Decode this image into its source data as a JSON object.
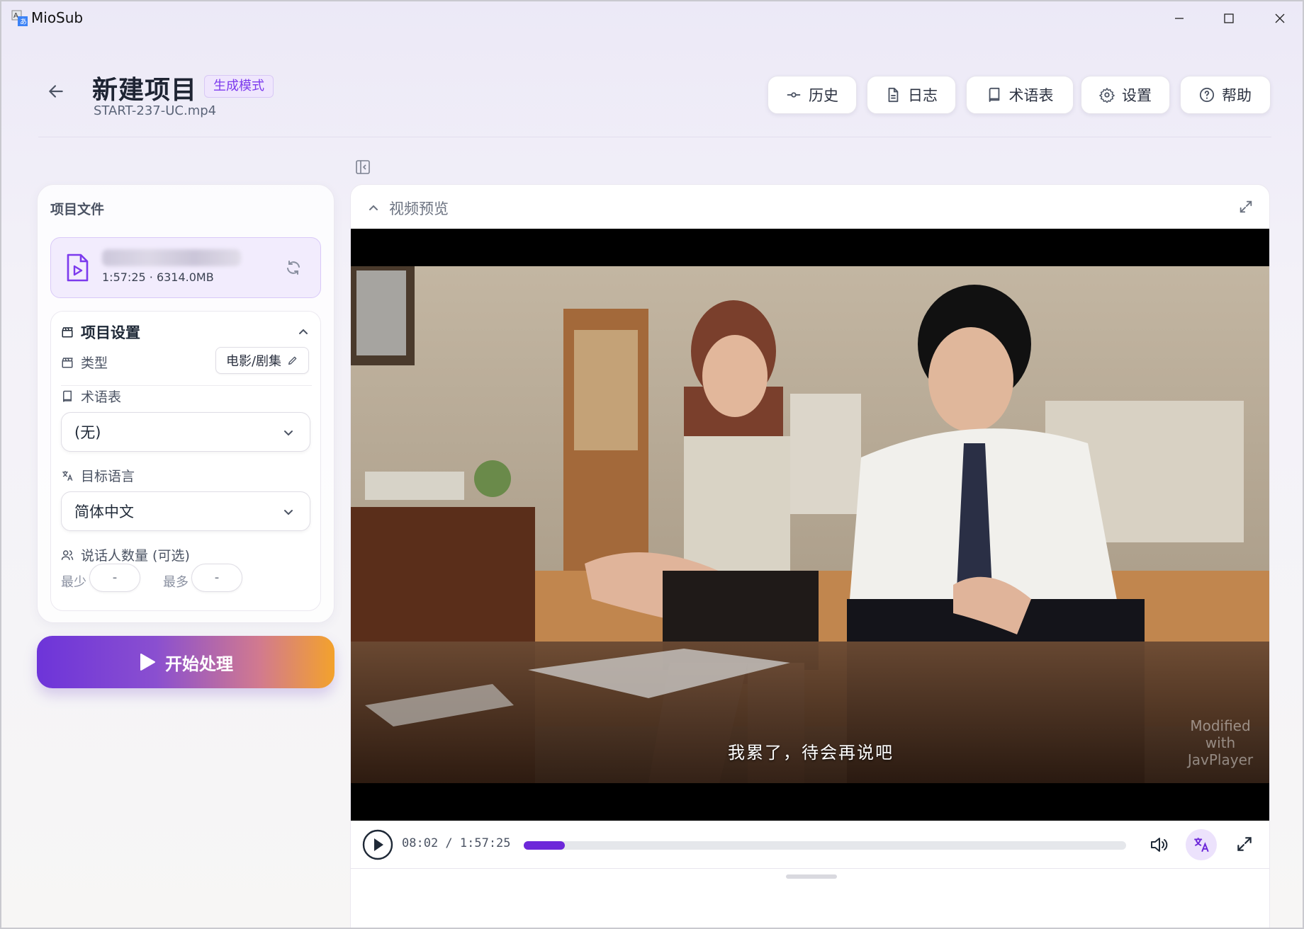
{
  "window": {
    "title": "MioSub"
  },
  "header": {
    "title": "新建项目",
    "mode_badge": "生成模式",
    "filename": "START-237-UC.mp4",
    "buttons": [
      {
        "label": "历史",
        "icon": "history-icon"
      },
      {
        "label": "日志",
        "icon": "document-icon"
      },
      {
        "label": "术语表",
        "icon": "book-icon"
      },
      {
        "label": "设置",
        "icon": "gear-icon"
      },
      {
        "label": "帮助",
        "icon": "help-icon"
      }
    ]
  },
  "sidebar": {
    "section_title": "项目文件",
    "file": {
      "meta": "1:57:25 · 6314.0MB"
    },
    "settings": {
      "title": "项目设置",
      "type_label": "类型",
      "type_value": "电影/剧集",
      "glossary_label": "术语表",
      "glossary_value": "(无)",
      "language_label": "目标语言",
      "language_value": "简体中文",
      "speakers_label": "说话人数量 (可选)",
      "min_label": "最少",
      "min_value": "-",
      "max_label": "最多",
      "max_value": "-"
    },
    "start_button": "开始处理"
  },
  "video": {
    "title": "视频预览",
    "subtitle": "我累了，待会再说吧",
    "watermark": [
      "Modified",
      "with",
      "JavPlayer"
    ],
    "time": "08:02 / 1:57:25",
    "progress": 0.068
  },
  "colors": {
    "accent": "#6d28d9",
    "badge_bg": "#efe6fd",
    "gradient_end": "#f3a22c"
  }
}
